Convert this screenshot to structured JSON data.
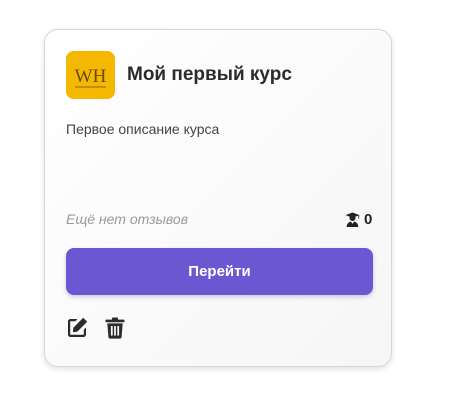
{
  "course": {
    "logo_text": "WH",
    "logo_color": "#f5b800",
    "title": "Мой первый курс",
    "description": "Первое описание курса",
    "reviews_text": "Ещё нет отзывов",
    "students_icon": "graduate-icon",
    "students_count": "0",
    "button_label": "Перейти",
    "button_color": "#6b57d2",
    "actions": [
      "edit-icon",
      "trash-icon"
    ]
  }
}
